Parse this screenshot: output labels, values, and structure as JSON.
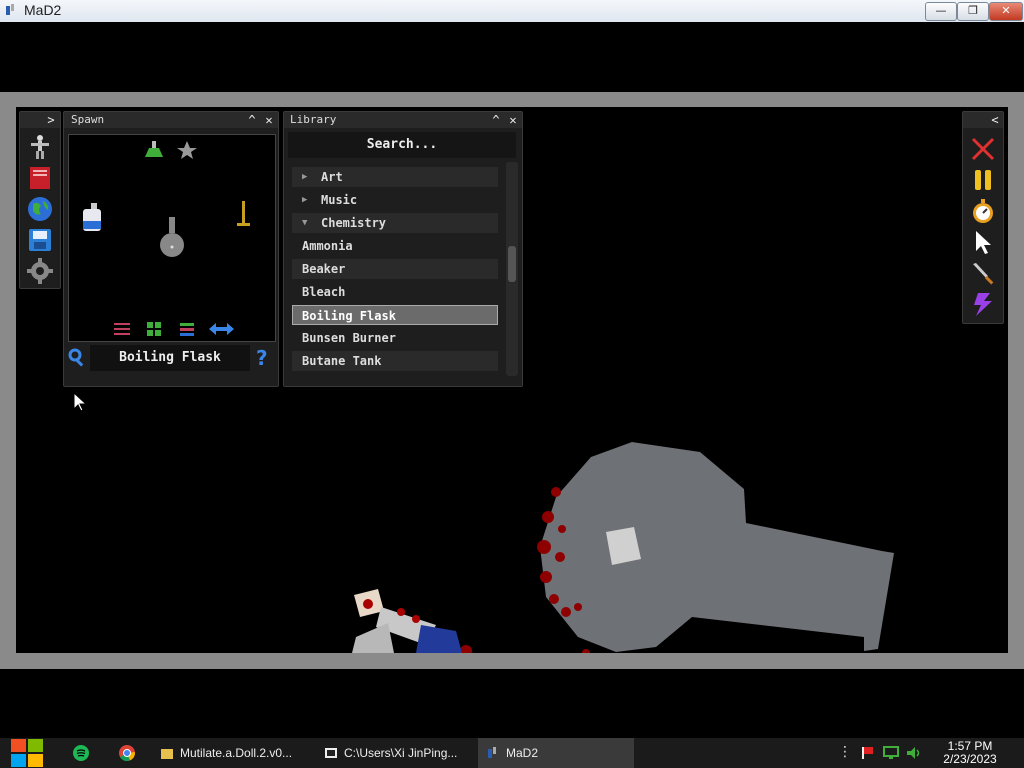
{
  "window": {
    "title": "MaD2",
    "minimize_label": "—",
    "maximize_label": "❐",
    "close_label": "✕"
  },
  "left_toolbar": {
    "expand_label": ">",
    "items": [
      {
        "name": "doll-tool-icon"
      },
      {
        "name": "book-icon"
      },
      {
        "name": "globe-icon"
      },
      {
        "name": "save-icon"
      },
      {
        "name": "settings-gear-icon"
      }
    ]
  },
  "spawn_panel": {
    "title": "Spawn",
    "collapse_label": "^",
    "close_label": "✕",
    "selected_item": "Boiling Flask",
    "help_label": "?"
  },
  "library_panel": {
    "title": "Library",
    "collapse_label": "^",
    "close_label": "✕",
    "search_label": "Search...",
    "rows": [
      {
        "label": "Art",
        "kind": "category"
      },
      {
        "label": "Music",
        "kind": "category"
      },
      {
        "label": "Chemistry",
        "kind": "category-open"
      },
      {
        "label": "Ammonia",
        "kind": "item"
      },
      {
        "label": "Beaker",
        "kind": "item"
      },
      {
        "label": "Bleach",
        "kind": "item"
      },
      {
        "label": "Boiling Flask",
        "kind": "item-selected"
      },
      {
        "label": "Bunsen Burner",
        "kind": "item"
      },
      {
        "label": "Butane Tank",
        "kind": "item"
      }
    ]
  },
  "right_toolbar": {
    "collapse_label": "<",
    "items": [
      "delete-icon",
      "pause-icon",
      "stopwatch-icon",
      "pointer-icon",
      "knife-icon",
      "lightning-icon"
    ]
  },
  "taskbar": {
    "tasks": [
      {
        "label": "Mutilate.a.Doll.2.v0..."
      },
      {
        "label": "C:\\Users\\Xi JinPing..."
      },
      {
        "label": "MaD2"
      }
    ],
    "time": "1:57 PM",
    "date": "2/23/2023"
  }
}
